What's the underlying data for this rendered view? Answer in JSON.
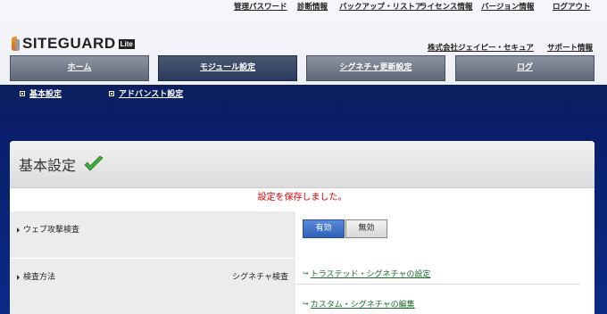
{
  "top_links": [
    "管理パスワード",
    "診断情報",
    "バックアップ・リストア",
    "ライセンス情報",
    "バージョン情報",
    "ログアウト"
  ],
  "logo": {
    "text": "SITEGUARD",
    "badge": "Lite"
  },
  "company_links": [
    "株式会社ジェイピー・セキュア",
    "サポート情報"
  ],
  "nav": [
    {
      "label": "ホーム"
    },
    {
      "label": "モジュール設定"
    },
    {
      "label": "シグネチャ更新設定"
    },
    {
      "label": "ログ"
    }
  ],
  "subnav": [
    "基本設定",
    "アドバンスト設定"
  ],
  "panel": {
    "title": "基本設定",
    "saved_message": "設定を保存しました。",
    "rows": {
      "web_attack": {
        "label": "ウェブ攻撃検査",
        "on": "有効",
        "off": "無効"
      },
      "method": {
        "label": "検査方法",
        "sub_label": "シグネチャ検査",
        "link1": "トラステッド・シグネチャの設定",
        "link2": "カスタム・シグネチャの編集"
      }
    }
  },
  "colors": {
    "accent": "#2e5fb8",
    "error": "#dd0000",
    "link": "#1a6a2a"
  }
}
